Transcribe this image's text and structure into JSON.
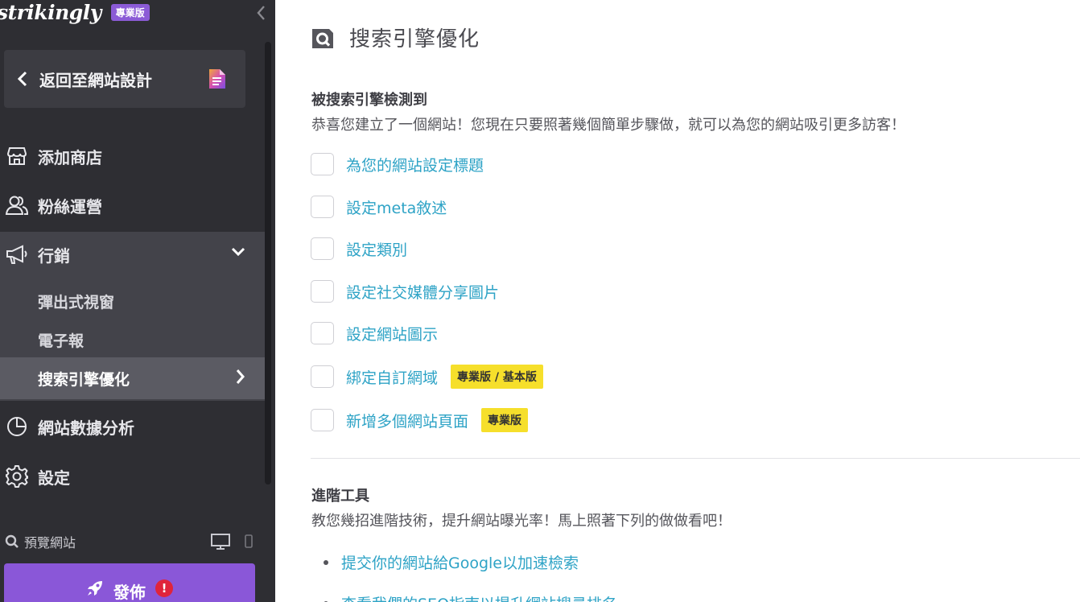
{
  "sidebar": {
    "logo_text": "strikingly",
    "plan_badge": "專業版",
    "back_label": "返回至網站設計",
    "nav": {
      "store": "添加商店",
      "fans": "粉絲運營",
      "marketing": "行銷",
      "analytics": "網站數據分析",
      "settings": "設定"
    },
    "marketing_sub": {
      "popup": "彈出式視窗",
      "newsletter": "電子報",
      "seo": "搜索引擎優化"
    },
    "preview_label": "預覽網站",
    "publish_label": "發佈",
    "publish_alert": "!"
  },
  "main": {
    "title": "搜索引擎優化",
    "section1": {
      "title": "被搜索引擎檢測到",
      "desc": "恭喜您建立了一個網站！您現在只要照著幾個簡單步驟做，就可以為您的網站吸引更多訪客！",
      "items": [
        {
          "label": "為您的網站設定標題"
        },
        {
          "label": "設定meta敘述"
        },
        {
          "label": "設定類別"
        },
        {
          "label": "設定社交媒體分享圖片"
        },
        {
          "label": "設定網站圖示"
        },
        {
          "label": "綁定自訂網域",
          "badge": "專業版 / 基本版"
        },
        {
          "label": "新增多個網站頁面",
          "badge": "專業版"
        }
      ]
    },
    "section2": {
      "title": "進階工具",
      "desc": "教您幾招進階技術，提升網站曝光率！馬上照著下列的做做看吧！",
      "links": [
        "提交你的網站給Google以加速檢索",
        "查看我們的SEO指南以提升網站搜尋排名"
      ]
    }
  },
  "colors": {
    "sidebar_bg": "#2e2e33",
    "accent_purple": "#8a57d8",
    "link_blue": "#2ea3c6",
    "badge_yellow": "#f6df2b",
    "alert_red": "#e0243b"
  }
}
